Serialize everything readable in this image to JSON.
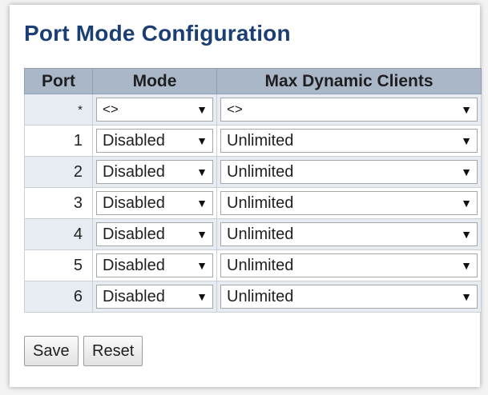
{
  "page": {
    "title": "Port Mode Configuration"
  },
  "table": {
    "headers": {
      "port": "Port",
      "mode": "Mode",
      "max_clients": "Max Dynamic Clients"
    },
    "rows": [
      {
        "port": "*",
        "mode": "<>",
        "max_clients": "<>"
      },
      {
        "port": "1",
        "mode": "Disabled",
        "max_clients": "Unlimited"
      },
      {
        "port": "2",
        "mode": "Disabled",
        "max_clients": "Unlimited"
      },
      {
        "port": "3",
        "mode": "Disabled",
        "max_clients": "Unlimited"
      },
      {
        "port": "4",
        "mode": "Disabled",
        "max_clients": "Unlimited"
      },
      {
        "port": "5",
        "mode": "Disabled",
        "max_clients": "Unlimited"
      },
      {
        "port": "6",
        "mode": "Disabled",
        "max_clients": "Unlimited"
      }
    ]
  },
  "buttons": {
    "save": "Save",
    "reset": "Reset"
  },
  "icons": {
    "dropdown_arrow": "▼"
  },
  "colors": {
    "title": "#1b3f73",
    "header_bg": "#a9b7c9",
    "row_alt_bg": "#e7ebf2"
  }
}
